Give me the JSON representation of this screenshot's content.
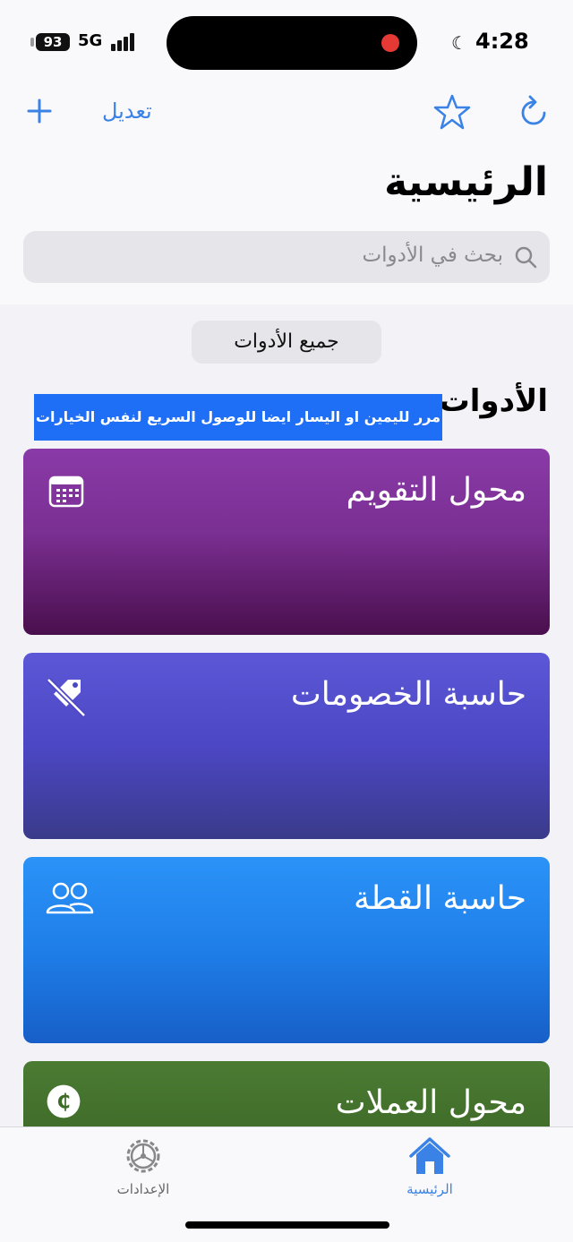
{
  "status_bar": {
    "battery": "93",
    "network": "5G",
    "time": "4:28"
  },
  "nav": {
    "edit_label": "تعديل"
  },
  "page_title": "الرئيسية",
  "search": {
    "placeholder": "بحث في الأدوات"
  },
  "all_tools_label": "جميع الأدوات",
  "section_title": "الأدوات",
  "hint_banner": "مرر لليمين او اليسار ايضا للوصول السريع لنفس الخيارات",
  "cards": [
    {
      "title": "محول التقويم",
      "icon": "calendar-icon",
      "color": "#8a3aa8"
    },
    {
      "title": "حاسبة الخصومات",
      "icon": "tag-slash-icon",
      "color": "#5b57d6"
    },
    {
      "title": "حاسبة القطة",
      "icon": "people-icon",
      "color": "#2a93f8"
    },
    {
      "title": "محول العملات",
      "icon": "currency-icon",
      "color": "#4b7b33"
    }
  ],
  "tabs": [
    {
      "label": "الإعدادات",
      "icon": "gear-icon",
      "active": false
    },
    {
      "label": "الرئيسية",
      "icon": "home-icon",
      "active": true
    }
  ],
  "accent_color": "#3b82e6"
}
